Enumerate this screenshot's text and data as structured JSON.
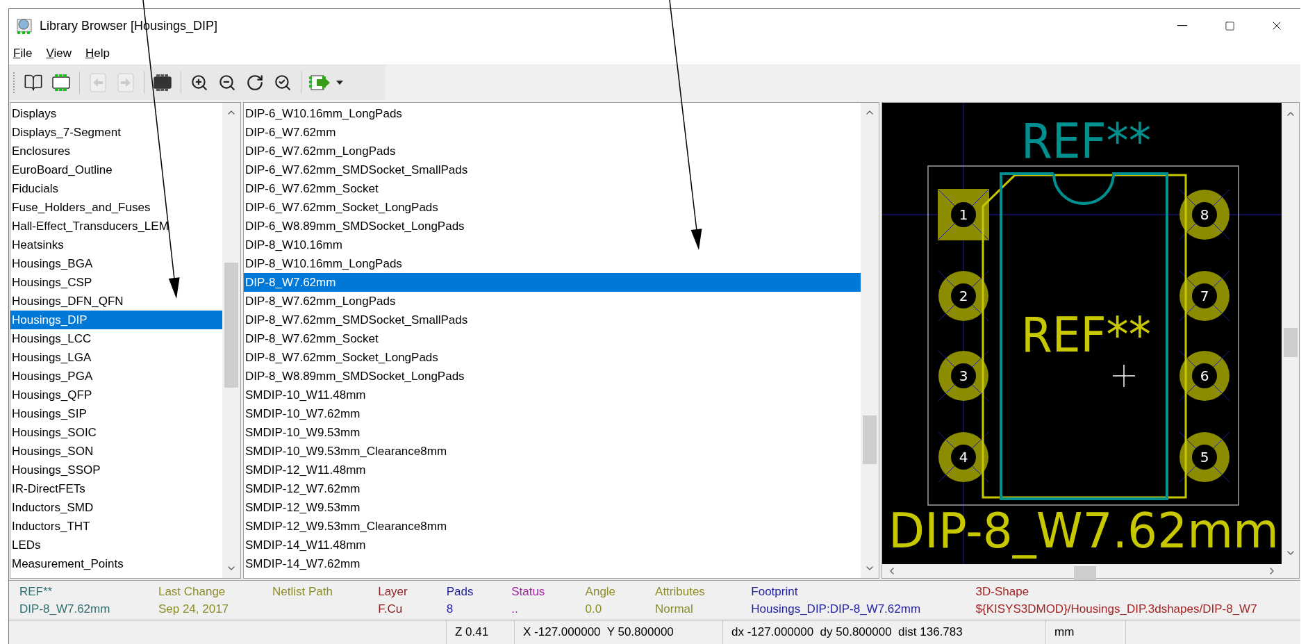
{
  "window": {
    "title": "Library Browser [Housings_DIP]"
  },
  "menu": [
    {
      "accel": "F",
      "rest": "ile"
    },
    {
      "accel": "V",
      "rest": "iew"
    },
    {
      "accel": "H",
      "rest": "elp"
    }
  ],
  "toolbar_groups": [
    [
      {
        "kind": "library",
        "disabled": false
      },
      {
        "kind": "footprint",
        "disabled": false
      }
    ],
    [
      {
        "kind": "back",
        "disabled": true
      },
      {
        "kind": "forward",
        "disabled": true
      }
    ],
    [
      {
        "kind": "viewer",
        "disabled": false
      }
    ],
    [
      {
        "kind": "zoom-in",
        "disabled": false
      },
      {
        "kind": "zoom-out",
        "disabled": false
      },
      {
        "kind": "redraw",
        "disabled": false
      },
      {
        "kind": "zoom-fit",
        "disabled": false
      }
    ],
    [
      {
        "kind": "export",
        "disabled": false
      },
      {
        "kind": "dropdown",
        "disabled": false
      }
    ]
  ],
  "libraries": [
    {
      "label": "Displays",
      "selected": false
    },
    {
      "label": "Displays_7-Segment",
      "selected": false
    },
    {
      "label": "Enclosures",
      "selected": false
    },
    {
      "label": "EuroBoard_Outline",
      "selected": false
    },
    {
      "label": "Fiducials",
      "selected": false
    },
    {
      "label": "Fuse_Holders_and_Fuses",
      "selected": false
    },
    {
      "label": "Hall-Effect_Transducers_LEM",
      "selected": false
    },
    {
      "label": "Heatsinks",
      "selected": false
    },
    {
      "label": "Housings_BGA",
      "selected": false
    },
    {
      "label": "Housings_CSP",
      "selected": false
    },
    {
      "label": "Housings_DFN_QFN",
      "selected": false
    },
    {
      "label": "Housings_DIP",
      "selected": true
    },
    {
      "label": "Housings_LCC",
      "selected": false
    },
    {
      "label": "Housings_LGA",
      "selected": false
    },
    {
      "label": "Housings_PGA",
      "selected": false
    },
    {
      "label": "Housings_QFP",
      "selected": false
    },
    {
      "label": "Housings_SIP",
      "selected": false
    },
    {
      "label": "Housings_SOIC",
      "selected": false
    },
    {
      "label": "Housings_SON",
      "selected": false
    },
    {
      "label": "Housings_SSOP",
      "selected": false
    },
    {
      "label": "IR-DirectFETs",
      "selected": false
    },
    {
      "label": "Inductors_SMD",
      "selected": false
    },
    {
      "label": "Inductors_THT",
      "selected": false
    },
    {
      "label": "LEDs",
      "selected": false
    },
    {
      "label": "Measurement_Points",
      "selected": false
    }
  ],
  "footprints": [
    {
      "label": "DIP-6_W10.16mm_LongPads",
      "selected": false
    },
    {
      "label": "DIP-6_W7.62mm",
      "selected": false
    },
    {
      "label": "DIP-6_W7.62mm_LongPads",
      "selected": false
    },
    {
      "label": "DIP-6_W7.62mm_SMDSocket_SmallPads",
      "selected": false
    },
    {
      "label": "DIP-6_W7.62mm_Socket",
      "selected": false
    },
    {
      "label": "DIP-6_W7.62mm_Socket_LongPads",
      "selected": false
    },
    {
      "label": "DIP-6_W8.89mm_SMDSocket_LongPads",
      "selected": false
    },
    {
      "label": "DIP-8_W10.16mm",
      "selected": false
    },
    {
      "label": "DIP-8_W10.16mm_LongPads",
      "selected": false
    },
    {
      "label": "DIP-8_W7.62mm",
      "selected": true
    },
    {
      "label": "DIP-8_W7.62mm_LongPads",
      "selected": false
    },
    {
      "label": "DIP-8_W7.62mm_SMDSocket_SmallPads",
      "selected": false
    },
    {
      "label": "DIP-8_W7.62mm_Socket",
      "selected": false
    },
    {
      "label": "DIP-8_W7.62mm_Socket_LongPads",
      "selected": false
    },
    {
      "label": "DIP-8_W8.89mm_SMDSocket_LongPads",
      "selected": false
    },
    {
      "label": "SMDIP-10_W11.48mm",
      "selected": false
    },
    {
      "label": "SMDIP-10_W7.62mm",
      "selected": false
    },
    {
      "label": "SMDIP-10_W9.53mm",
      "selected": false
    },
    {
      "label": "SMDIP-10_W9.53mm_Clearance8mm",
      "selected": false
    },
    {
      "label": "SMDIP-12_W11.48mm",
      "selected": false
    },
    {
      "label": "SMDIP-12_W7.62mm",
      "selected": false
    },
    {
      "label": "SMDIP-12_W9.53mm",
      "selected": false
    },
    {
      "label": "SMDIP-12_W9.53mm_Clearance8mm",
      "selected": false
    },
    {
      "label": "SMDIP-14_W11.48mm",
      "selected": false
    },
    {
      "label": "SMDIP-14_W7.62mm",
      "selected": false
    }
  ],
  "preview": {
    "reference": "REF**",
    "value": "REF**",
    "footprint_name": "DIP-8_W7.62mm",
    "pads": [
      {
        "number": "1",
        "kind": "square"
      },
      {
        "number": "8",
        "kind": "round"
      },
      {
        "number": "2",
        "kind": "round"
      },
      {
        "number": "7",
        "kind": "round"
      },
      {
        "number": "3",
        "kind": "round"
      },
      {
        "number": "6",
        "kind": "round"
      },
      {
        "number": "4",
        "kind": "round"
      },
      {
        "number": "5",
        "kind": "round"
      }
    ]
  },
  "info": [
    {
      "label": "REF**",
      "value": "DIP-8_W7.62mm",
      "color": "#2f6e6e"
    },
    {
      "label": "Last Change",
      "value": "Sep 24, 2017",
      "color": "#8c8c28"
    },
    {
      "label": "Netlist Path",
      "color": "#8c8c28"
    },
    {
      "label": "Layer",
      "value": "F.Cu",
      "color": "#8c1c1c"
    },
    {
      "label": "Pads",
      "value": "8",
      "color": "#2424a0"
    },
    {
      "label": "Status",
      "value": "..",
      "color": "#a424a4"
    },
    {
      "label": "Angle",
      "value": "0.0",
      "color": "#8c8c28"
    },
    {
      "label": "Attributes",
      "value": "Normal",
      "color": "#8c8c28"
    },
    {
      "label": "Footprint",
      "value": "Housings_DIP:DIP-8_W7.62mm",
      "color": "#2424a0"
    },
    {
      "label": "3D-Shape",
      "value": "${KISYS3DMOD}/Housings_DIP.3dshapes/DIP-8_W7",
      "color": "#a42424"
    }
  ],
  "status_bar": [
    {
      "kind": "blank"
    },
    {
      "kind": "zoom",
      "text": "Z 0.41"
    },
    {
      "kind": "cursor",
      "text": "X -127.000000  Y 50.800000"
    },
    {
      "kind": "delta",
      "text": "dx -127.000000  dy 50.800000  dist 136.783"
    },
    {
      "kind": "units",
      "text": "mm"
    },
    {
      "kind": "blank"
    }
  ]
}
